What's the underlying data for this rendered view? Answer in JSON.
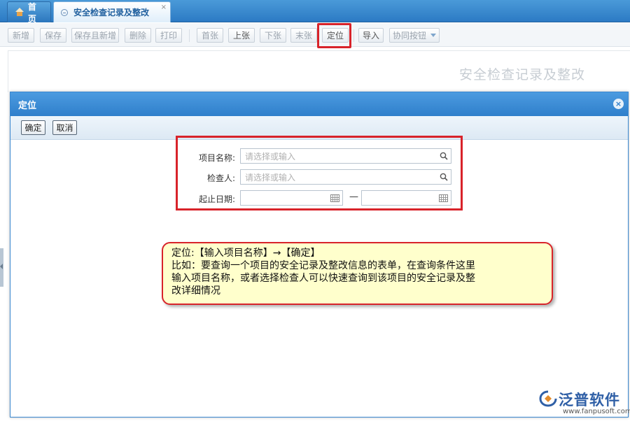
{
  "tabs": {
    "home": "首页",
    "active": "安全检查记录及整改",
    "close_glyph": "×"
  },
  "toolbar": {
    "new": "新增",
    "save": "保存",
    "save_new": "保存且新增",
    "delete": "删除",
    "print": "打印",
    "first": "首张",
    "prev": "上张",
    "next": "下张",
    "last": "末张",
    "locate": "定位",
    "import": "导入",
    "collab": "协同按钮"
  },
  "page": {
    "heading": "安全检查记录及整改"
  },
  "dialog": {
    "title": "定位",
    "confirm": "确定",
    "cancel": "取消",
    "close_glyph": "×",
    "fields": {
      "project_label": "项目名称:",
      "project_placeholder": "请选择或输入",
      "inspector_label": "检查人:",
      "inspector_placeholder": "请选择或输入",
      "date_label": "起止日期:",
      "date_start": "",
      "date_end": "",
      "range_dash": "—"
    }
  },
  "note": {
    "line1": "定位:【输入项目名称】→【确定】",
    "line2": "比如：要查询一个项目的安全记录及整改信息的表单，在查询条件这里",
    "line3": "输入项目名称，或者选择检查人可以快速查询到该项目的安全记录及整",
    "line4": "改详细情况"
  },
  "logo": {
    "name": "泛普软件",
    "url": "www.fanpusoft.com"
  },
  "colors": {
    "tab_bar": "#2c7ac4",
    "dialog_header": "#3a87cf",
    "highlight": "#d8232a",
    "note_bg": "#ffffcc"
  }
}
